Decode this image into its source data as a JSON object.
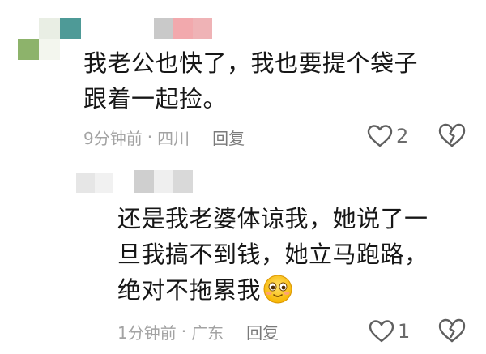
{
  "comment1": {
    "text": "我老公也快了，我也要提个袋子\n跟着一起捡。",
    "time": "9分钟前",
    "separator": "·",
    "location": "四川",
    "reply_label": "回复",
    "like_count": "2"
  },
  "comment2": {
    "text": "还是我老婆体谅我，她说了一\n旦我搞不到钱，她立马跑路，\n绝对不拖累我",
    "emoji": "blushing-face-emoji",
    "time": "1分钟前",
    "separator": "·",
    "location": "广东",
    "reply_label": "回复",
    "like_count": "1"
  },
  "icons": {
    "like": "heart-outline-icon",
    "dislike": "broken-heart-icon"
  },
  "colors": {
    "text": "#161616",
    "meta": "#a3a3a3",
    "icon": "#5f5f5f"
  }
}
